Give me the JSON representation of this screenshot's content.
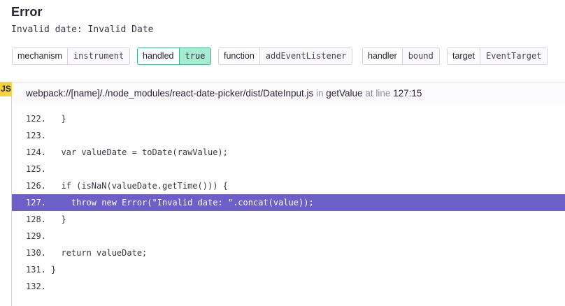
{
  "error": {
    "title": "Error",
    "message": "Invalid date: Invalid Date"
  },
  "tags": [
    {
      "key": "mechanism",
      "value": "instrument"
    },
    {
      "key": "handled",
      "value": "true",
      "highlight": true
    },
    {
      "key": "function",
      "value": "addEventListener"
    },
    {
      "key": "handler",
      "value": "bound"
    },
    {
      "key": "target",
      "value": "EventTarget"
    }
  ],
  "frame": {
    "platform_badge": "JS",
    "filename": "webpack://[name]/./node_modules/react-date-picker/dist/DateInput.js",
    "in_label": "in",
    "function": "getValue",
    "at_line_label": "at line",
    "location": "127:15"
  },
  "code_lines": [
    {
      "num": "122.",
      "code": "  }"
    },
    {
      "num": "123.",
      "code": ""
    },
    {
      "num": "124.",
      "code": "  var valueDate = toDate(rawValue);"
    },
    {
      "num": "125.",
      "code": ""
    },
    {
      "num": "126.",
      "code": "  if (isNaN(valueDate.getTime())) {"
    },
    {
      "num": "127.",
      "code": "    throw new Error(\"Invalid date: \".concat(value));",
      "active": true
    },
    {
      "num": "128.",
      "code": "  }"
    },
    {
      "num": "129.",
      "code": ""
    },
    {
      "num": "130.",
      "code": "  return valueDate;"
    },
    {
      "num": "131.",
      "code": "}"
    },
    {
      "num": "132.",
      "code": ""
    }
  ]
}
